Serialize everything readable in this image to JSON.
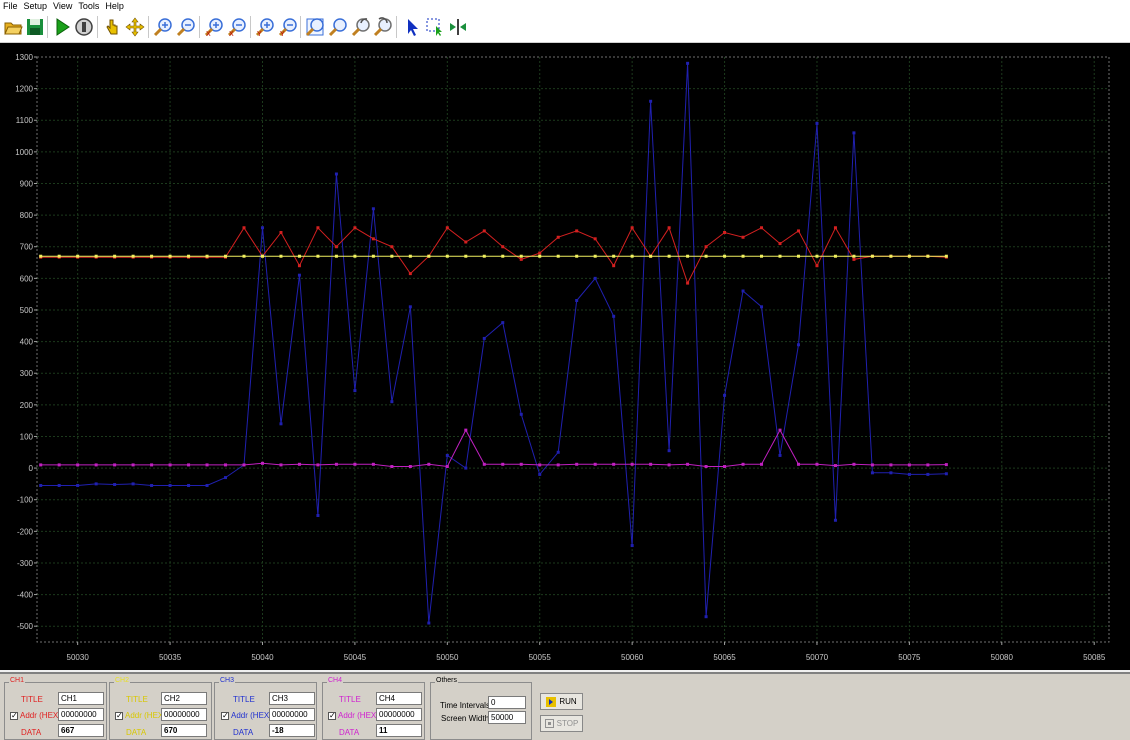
{
  "menu": [
    "File",
    "Setup",
    "View",
    "Tools",
    "Help"
  ],
  "toolbar": [
    {
      "name": "open-folder-icon",
      "color": "#e8b020"
    },
    {
      "name": "save-icon",
      "color": "#1a8f3c"
    },
    {
      "name": "play-icon",
      "color": "#1aa01a"
    },
    {
      "name": "stop-icon",
      "color": "#404040"
    },
    {
      "name": "pointer-hand-icon",
      "color": "#e8c000"
    },
    {
      "name": "pan-icon",
      "color": "#e8c000"
    },
    {
      "name": "zoom-in-icon",
      "color": "#3a6fd8"
    },
    {
      "name": "zoom-out-icon",
      "color": "#3a6fd8"
    },
    {
      "name": "zoom-in-x-icon",
      "color": "#3a6fd8"
    },
    {
      "name": "zoom-out-x-icon",
      "color": "#3a6fd8"
    },
    {
      "name": "zoom-in-y-icon",
      "color": "#3a6fd8"
    },
    {
      "name": "zoom-out-y-icon",
      "color": "#3a6fd8"
    },
    {
      "name": "zoom-fit-icon",
      "color": "#3a6fd8"
    },
    {
      "name": "zoom-search-icon",
      "color": "#3a6fd8"
    },
    {
      "name": "undo-zoom-icon",
      "color": "#808080"
    },
    {
      "name": "redo-zoom-icon",
      "color": "#808080"
    },
    {
      "name": "select-arrow-icon",
      "color": "#1030c0"
    },
    {
      "name": "select-region-icon",
      "color": "#1030c0"
    },
    {
      "name": "split-view-icon",
      "color": "#1a8f3c"
    }
  ],
  "chart_data": {
    "type": "line",
    "grid": true,
    "xlim": [
      50027.8,
      50085.8
    ],
    "ylim": [
      -550,
      1300
    ],
    "x_ticks": [
      50030,
      50035,
      50040,
      50045,
      50050,
      50055,
      50060,
      50065,
      50070,
      50075,
      50080,
      50085
    ],
    "y_ticks": [
      1300,
      1200,
      1100,
      1000,
      900,
      800,
      700,
      600,
      500,
      400,
      300,
      200,
      100,
      0,
      -100,
      -200,
      -300,
      -400,
      -500
    ],
    "x": [
      50028,
      50029,
      50030,
      50031,
      50032,
      50033,
      50034,
      50035,
      50036,
      50037,
      50038,
      50039,
      50040,
      50041,
      50042,
      50043,
      50044,
      50045,
      50046,
      50047,
      50048,
      50049,
      50050,
      50051,
      50052,
      50053,
      50054,
      50055,
      50056,
      50057,
      50058,
      50059,
      50060,
      50061,
      50062,
      50063,
      50064,
      50065,
      50066,
      50067,
      50068,
      50069,
      50070,
      50071,
      50072,
      50073,
      50074,
      50075,
      50076,
      50077
    ],
    "series": [
      {
        "color": "#d42020",
        "values": [
          667,
          667,
          667,
          667,
          667,
          667,
          667,
          667,
          667,
          667,
          667,
          760,
          670,
          745,
          640,
          760,
          700,
          760,
          725,
          700,
          615,
          670,
          760,
          715,
          750,
          700,
          660,
          680,
          730,
          750,
          725,
          640,
          760,
          670,
          760,
          585,
          700,
          745,
          730,
          760,
          710,
          750,
          640,
          760,
          660,
          670,
          670,
          670,
          670,
          667
        ]
      },
      {
        "color": "#f0f060",
        "values": [
          670,
          670,
          670,
          670,
          670,
          670,
          670,
          670,
          670,
          670,
          670,
          670,
          670,
          670,
          670,
          670,
          670,
          670,
          670,
          670,
          670,
          670,
          670,
          670,
          670,
          670,
          670,
          670,
          670,
          670,
          670,
          670,
          670,
          670,
          670,
          670,
          670,
          670,
          670,
          670,
          670,
          670,
          670,
          670,
          670,
          670,
          670,
          670,
          670,
          670
        ]
      },
      {
        "color": "#2020b0",
        "values": [
          -55,
          -55,
          -55,
          -50,
          -52,
          -50,
          -55,
          -55,
          -55,
          -55,
          -30,
          10,
          760,
          140,
          610,
          -150,
          930,
          245,
          820,
          210,
          510,
          -490,
          40,
          0,
          410,
          460,
          170,
          -20,
          50,
          530,
          600,
          480,
          -245,
          1160,
          55,
          1280,
          -470,
          230,
          560,
          510,
          40,
          390,
          1090,
          -165,
          1060,
          -15,
          -15,
          -20,
          -20,
          -18
        ]
      },
      {
        "color": "#c020c0",
        "values": [
          10,
          10,
          10,
          10,
          10,
          10,
          10,
          10,
          10,
          10,
          10,
          10,
          15,
          10,
          12,
          10,
          12,
          12,
          12,
          5,
          5,
          12,
          5,
          120,
          12,
          12,
          12,
          10,
          10,
          12,
          12,
          12,
          12,
          12,
          10,
          12,
          5,
          5,
          12,
          12,
          120,
          12,
          12,
          8,
          12,
          10,
          10,
          10,
          10,
          11
        ]
      }
    ]
  },
  "channels": [
    {
      "group": "CH1",
      "title_label": "TITLE",
      "addr_label": "Addr (HEX)",
      "data_label": "DATA",
      "title": "CH1",
      "addr": "00000000",
      "data": "667",
      "color": "#e02020"
    },
    {
      "group": "CH2",
      "title_label": "TITLE",
      "addr_label": "Addr (HEX)",
      "data_label": "DATA",
      "title": "CH2",
      "addr": "00000000",
      "data": "670",
      "color": "#e8e020"
    },
    {
      "group": "CH3",
      "title_label": "TITLE",
      "addr_label": "Addr (HEX)",
      "data_label": "DATA",
      "title": "CH3",
      "addr": "00000000",
      "data": "-18",
      "color": "#2030d0"
    },
    {
      "group": "CH4",
      "title_label": "TITLE",
      "addr_label": "Addr (HEX)",
      "data_label": "DATA",
      "title": "CH4",
      "addr": "00000000",
      "data": "11",
      "color": "#d020d0"
    }
  ],
  "others": {
    "group": "Others",
    "time_intervals_label": "Time Intervals",
    "time_intervals": "0",
    "screen_width_label": "Screen Width",
    "screen_width": "50000"
  },
  "buttons": {
    "run": "RUN",
    "stop": "STOP"
  }
}
